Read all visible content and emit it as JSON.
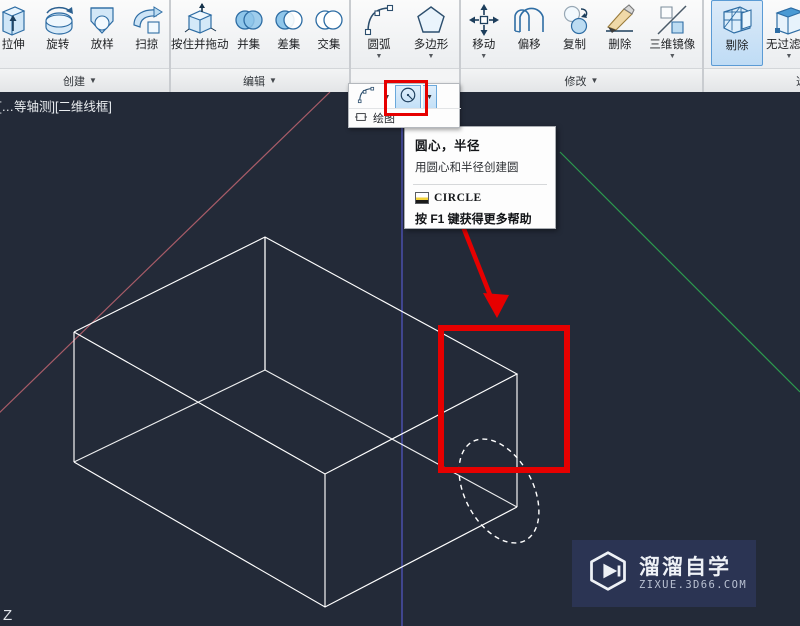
{
  "ribbon": {
    "panels": [
      {
        "label": "创建",
        "caret": "▼",
        "tools": [
          {
            "name": "extrude",
            "label": "拉伸",
            "icon": "extrude-icon",
            "caret": ""
          },
          {
            "name": "revolve",
            "label": "旋转",
            "icon": "revolve-icon",
            "caret": ""
          },
          {
            "name": "loft",
            "label": "放样",
            "icon": "loft-icon",
            "caret": ""
          },
          {
            "name": "sweep",
            "label": "扫掠",
            "icon": "sweep-icon",
            "caret": ""
          }
        ]
      },
      {
        "label": "编辑",
        "caret": "▼",
        "tools": [
          {
            "name": "presspull",
            "label": "按住并拖动",
            "icon": "presspull-icon",
            "caret": ""
          },
          {
            "name": "union",
            "label": "并集",
            "icon": "union-icon",
            "caret": ""
          },
          {
            "name": "subtract",
            "label": "差集",
            "icon": "subtract-icon",
            "caret": ""
          },
          {
            "name": "intersect",
            "label": "交集",
            "icon": "intersect-icon",
            "caret": ""
          }
        ]
      },
      {
        "label": "",
        "caret": "",
        "tools": [
          {
            "name": "arc",
            "label": "圆弧",
            "icon": "arc-icon",
            "caret": "▼"
          },
          {
            "name": "polygon",
            "label": "多边形",
            "icon": "polygon-icon",
            "caret": "▼"
          }
        ]
      },
      {
        "label": "修改",
        "caret": "▼",
        "tools": [
          {
            "name": "move",
            "label": "移动",
            "icon": "move-icon",
            "caret": "▼"
          },
          {
            "name": "offset",
            "label": "偏移",
            "icon": "offset-icon",
            "caret": ""
          },
          {
            "name": "copy",
            "label": "复制",
            "icon": "copy-icon",
            "caret": ""
          },
          {
            "name": "erase",
            "label": "删除",
            "icon": "erase-icon",
            "caret": ""
          },
          {
            "name": "mirror3d",
            "label": "三维镜像",
            "icon": "mirror3d-icon",
            "caret": "▼"
          }
        ]
      },
      {
        "label": "选择",
        "caret": "",
        "tools": [
          {
            "name": "cull",
            "label": "剔除",
            "icon": "cull-icon",
            "caret": "",
            "selected": true
          },
          {
            "name": "nofilter",
            "label": "无过滤器",
            "icon": "nofilter-icon",
            "caret": "▼"
          }
        ]
      }
    ]
  },
  "flyout": {
    "label": "绘图",
    "arc_icon": "arc-icon",
    "circle_icon": "circle-center-radius-icon",
    "split_caret": "▼",
    "arc_caret": "▼",
    "anchor_icon": "pin-icon"
  },
  "tooltip": {
    "title": "圆心，半径",
    "description": "用圆心和半径创建圆",
    "command_icon": "circle-command-icon",
    "command": "CIRCLE",
    "help": "按 F1 键获得更多帮助"
  },
  "viewport": {
    "label": "[…等轴测][二维线框]",
    "axis_label_z": "Z",
    "background_color": "#232a38",
    "wireframe_color": "#ffffff",
    "axis_x_color": "#b4616d",
    "axis_y_color": "#2f9d53",
    "axis_z_color": "#5b5fcf",
    "ellipse_style": "dashed",
    "ellipse_color": "#ffffff"
  },
  "annotations": {
    "highlight_color": "#e60000",
    "arrow_name": "red-pointer-arrow",
    "box_name": "red-highlight-box",
    "tool_box_name": "red-tool-highlight-box"
  },
  "watermark": {
    "brand": "溜溜自学",
    "domain": "ZIXUE.3D66.COM",
    "logo_icon": "play-button-logo",
    "background_color": "#2b3453"
  }
}
